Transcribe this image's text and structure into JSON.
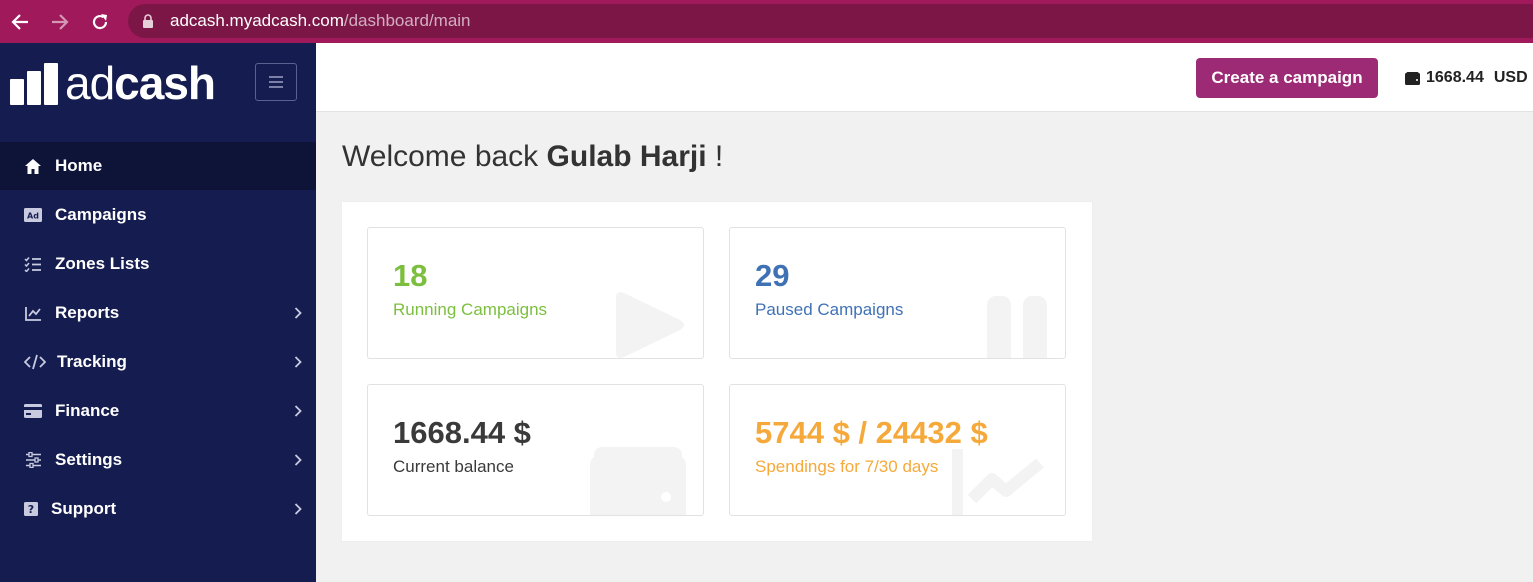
{
  "browser": {
    "url_host": "adcash.myadcash.com",
    "url_path": "/dashboard/main"
  },
  "brand": {
    "logo_prefix": "ad",
    "logo_suffix": "cash"
  },
  "sidebar": {
    "items": [
      {
        "label": "Home",
        "icon": "home-icon",
        "active": true,
        "has_submenu": false
      },
      {
        "label": "Campaigns",
        "icon": "ad-icon",
        "active": false,
        "has_submenu": false
      },
      {
        "label": "Zones Lists",
        "icon": "checklist-icon",
        "active": false,
        "has_submenu": false
      },
      {
        "label": "Reports",
        "icon": "chart-icon",
        "active": false,
        "has_submenu": true
      },
      {
        "label": "Tracking",
        "icon": "code-icon",
        "active": false,
        "has_submenu": true
      },
      {
        "label": "Finance",
        "icon": "card-icon",
        "active": false,
        "has_submenu": true
      },
      {
        "label": "Settings",
        "icon": "sliders-icon",
        "active": false,
        "has_submenu": true
      },
      {
        "label": "Support",
        "icon": "help-icon",
        "active": false,
        "has_submenu": true
      }
    ]
  },
  "header": {
    "create_label": "Create a campaign",
    "balance": "1668.44",
    "currency": "USD"
  },
  "welcome": {
    "prefix": "Welcome back",
    "name": "Gulab Harji",
    "suffix": "!"
  },
  "cards": {
    "running": {
      "value": "18",
      "label": "Running Campaigns"
    },
    "paused": {
      "value": "29",
      "label": "Paused Campaigns"
    },
    "balance": {
      "value": "1668.44 $",
      "label": "Current balance"
    },
    "spendings": {
      "value": "5744 $ / 24432 $",
      "label": "Spendings for 7/30 days"
    }
  },
  "colors": {
    "browser_bar": "#a0195a",
    "sidebar": "#151c4f",
    "sidebar_active": "#0e1338",
    "button": "#9c2a74",
    "running": "#7cbf3f",
    "paused": "#3f72b5",
    "spendings": "#f5a93a"
  }
}
